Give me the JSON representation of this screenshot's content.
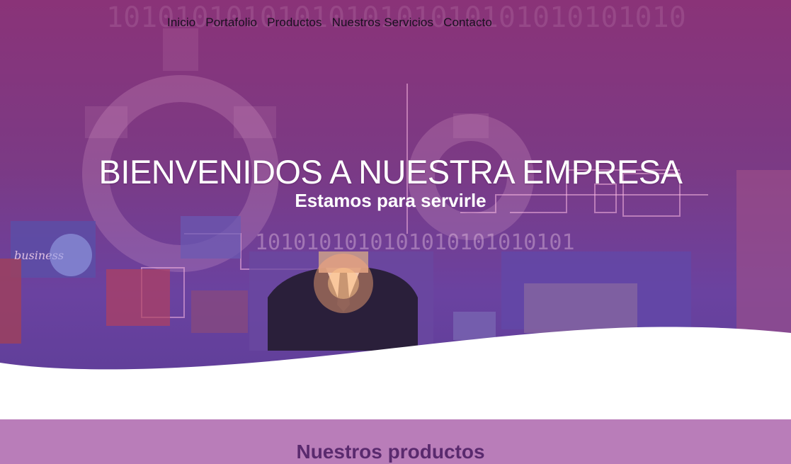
{
  "nav": {
    "items": [
      "Inicio",
      "Portafolio",
      "Productos",
      "Nuestros Servicios",
      "Contacto"
    ]
  },
  "hero": {
    "title": "BIENVENIDOS A NUESTRA EMPRESA",
    "subtitle": "Estamos para servirle",
    "background_text": "business",
    "binary_strip": "10101010101010101010",
    "colors": {
      "overlay": "#8a3378",
      "accent": "#6a42a0",
      "wave": "#ffffff"
    }
  },
  "products": {
    "title": "Nuestros productos",
    "band_color": "#b97db9"
  }
}
